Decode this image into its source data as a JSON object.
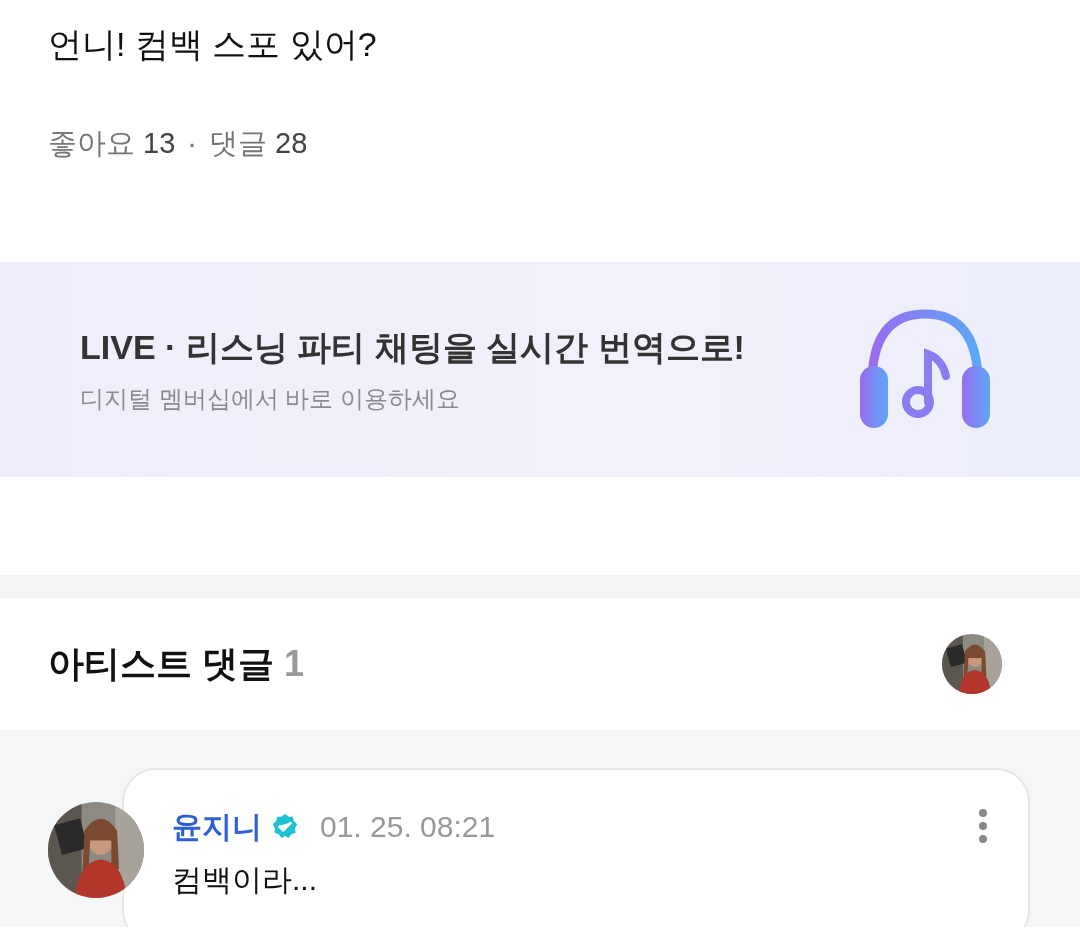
{
  "post": {
    "text": "언니! 컴백 스포 있어?",
    "likes_label": "좋아요",
    "likes": "13",
    "separator": "·",
    "comments_label": "댓글",
    "comments": "28"
  },
  "banner": {
    "title": "LIVE · 리스닝 파티 채팅을 실시간 번역으로!",
    "subtitle": "디지털 멤버십에서 바로 이용하세요"
  },
  "artist_comments": {
    "title": "아티스트 댓글",
    "count": "1",
    "comments": [
      {
        "author": "윤지니",
        "verified": true,
        "time": "01. 25. 08:21",
        "text": "컴백이라..."
      }
    ]
  }
}
